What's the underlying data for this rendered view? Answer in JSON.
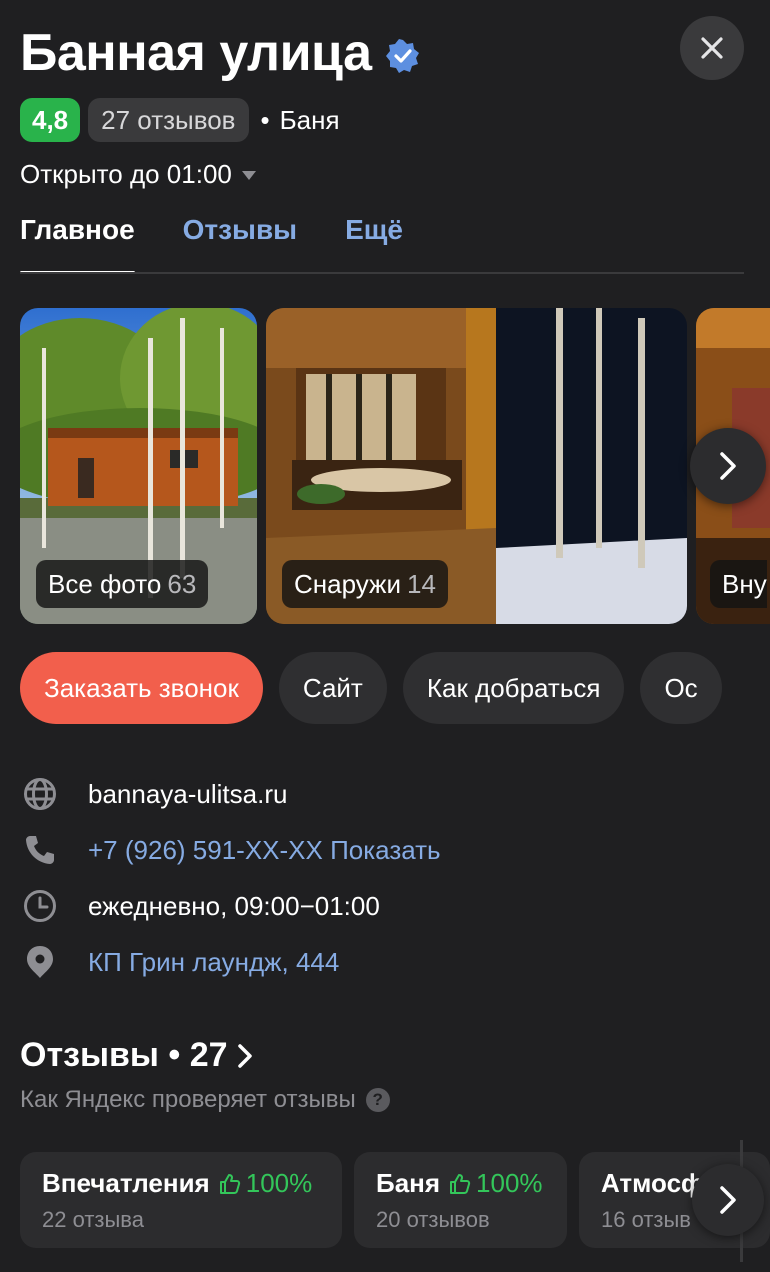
{
  "header": {
    "title": "Банная улица",
    "rating": "4,8",
    "reviews_count": "27 отзывов",
    "separator": "•",
    "category": "Баня",
    "hours_status": "Открыто до 01:00"
  },
  "tabs": [
    {
      "label": "Главное"
    },
    {
      "label": "Отзывы"
    },
    {
      "label": "Ещё"
    }
  ],
  "photos": [
    {
      "label": "Все фото",
      "count": "63"
    },
    {
      "label": "Снаружи",
      "count": "14"
    },
    {
      "label": "Вну",
      "count": ""
    }
  ],
  "actions": [
    {
      "label": "Заказать звонок"
    },
    {
      "label": "Сайт"
    },
    {
      "label": "Как добраться"
    },
    {
      "label": "Ос"
    }
  ],
  "info": {
    "website": "bannaya-ulitsa.ru",
    "phone": "+7 (926) 591-XX-XX Показать",
    "schedule": "ежедневно, 09:00−01:00",
    "address": "КП Грин лаундж, 444"
  },
  "reviews": {
    "title": "Отзывы • 27",
    "subtitle": "Как Яндекс проверяет отзывы",
    "help_glyph": "?",
    "aspects": [
      {
        "name": "Впечатления",
        "percent": "100%",
        "count": "22 отзыва"
      },
      {
        "name": "Баня",
        "percent": "100%",
        "count": "20 отзывов"
      },
      {
        "name": "Атмосф",
        "percent": "",
        "count": "16 отзыв"
      }
    ]
  },
  "colors": {
    "background": "#1f1f21",
    "rating_green": "#29b34b",
    "primary_button": "#f25f4c",
    "link": "#86abe3",
    "positive": "#33c65a"
  }
}
